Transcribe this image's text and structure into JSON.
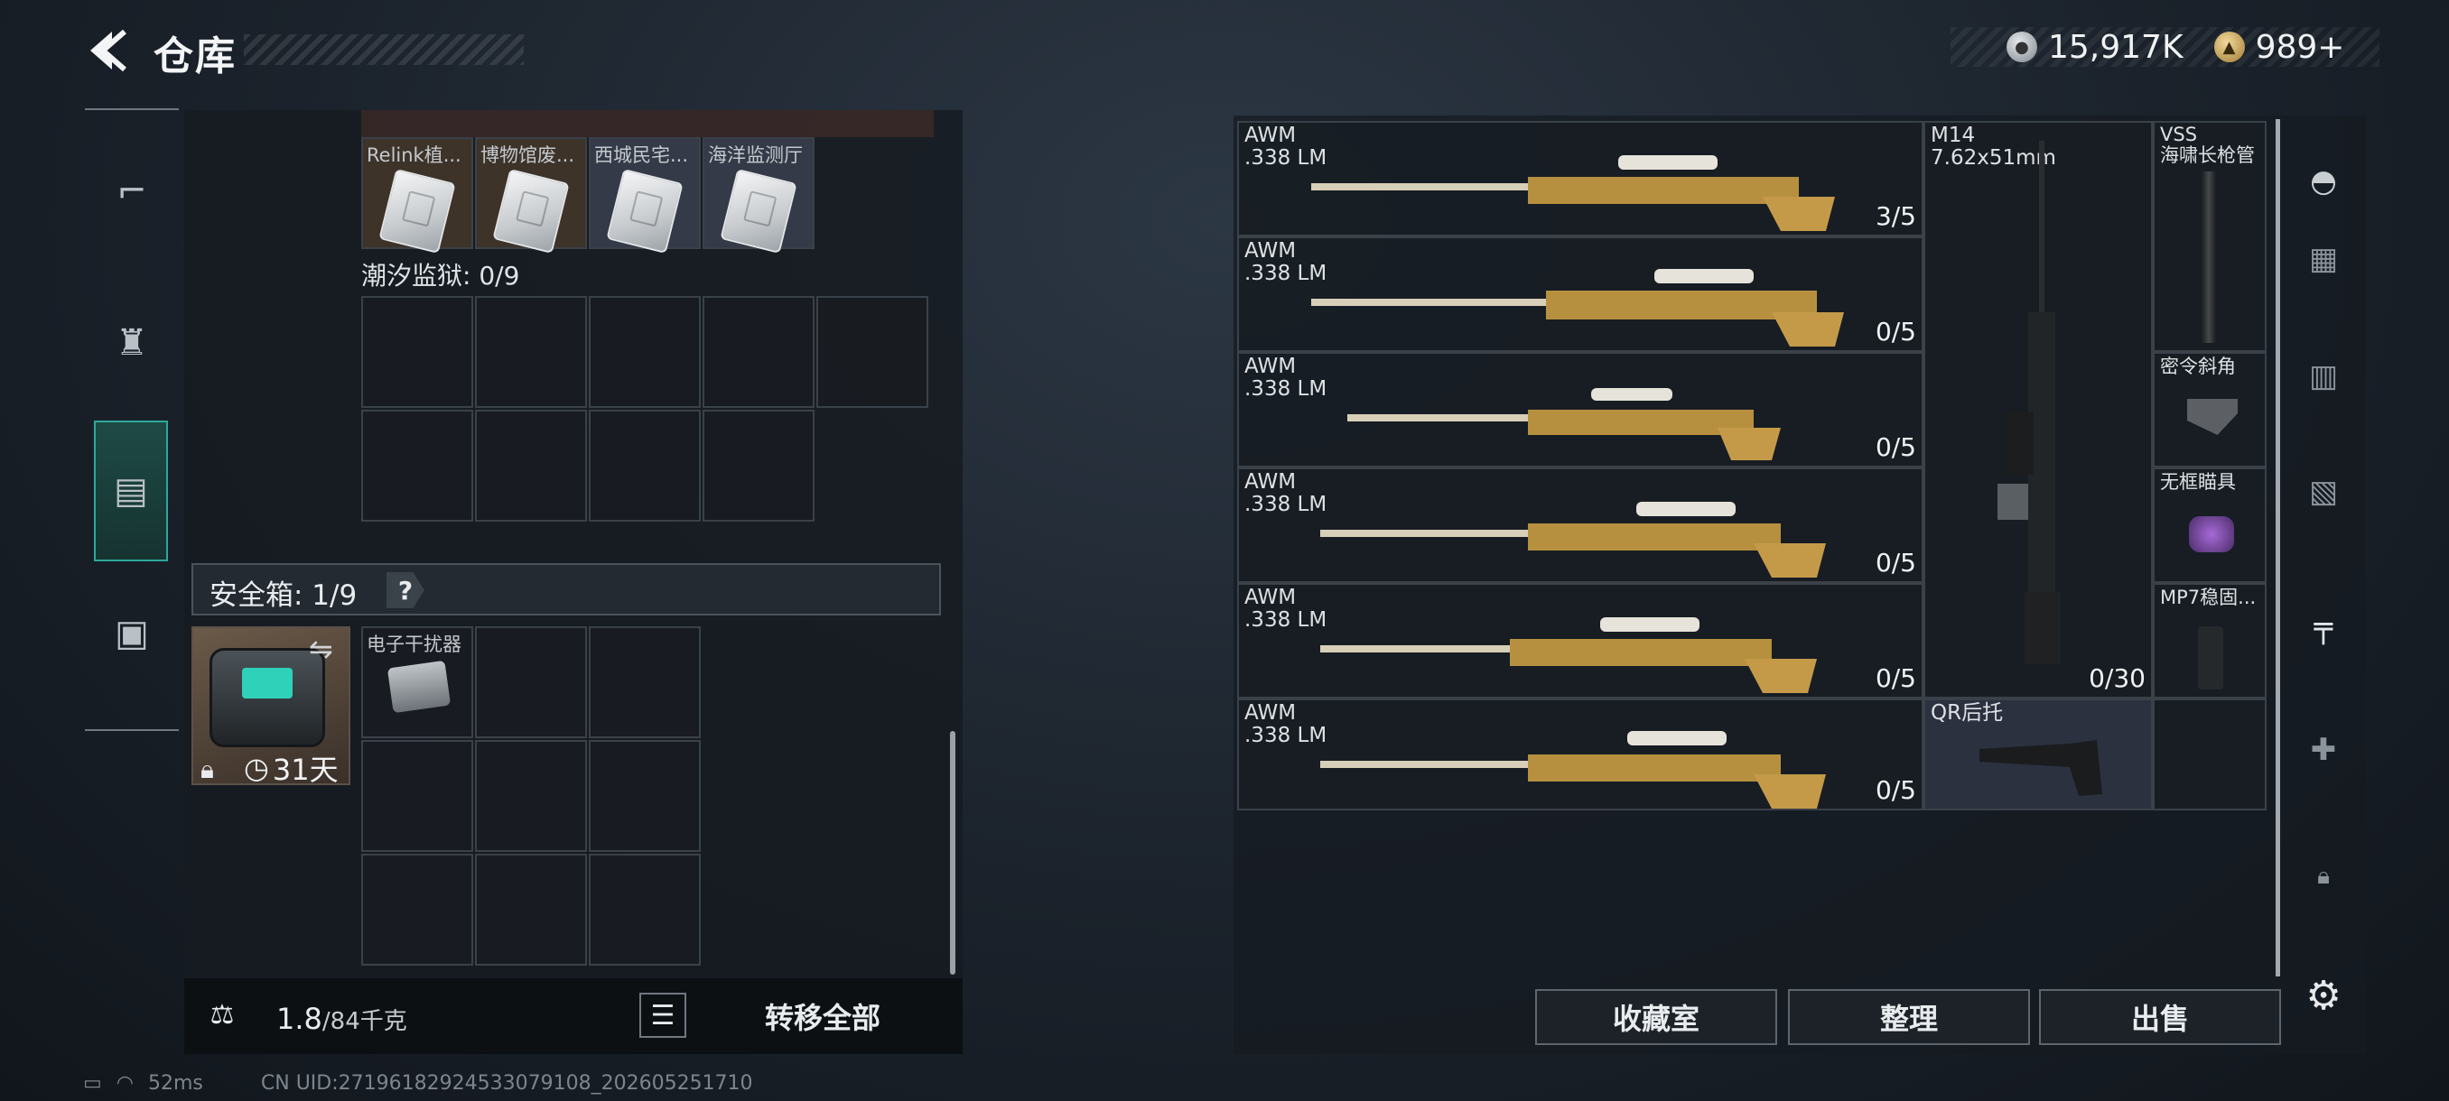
{
  "header": {
    "back_icon": "back-arrow-icon",
    "title": "仓库",
    "currency": [
      {
        "icon": "silver-coin-icon",
        "value": "15,917K"
      },
      {
        "icon": "gold-coin-icon",
        "value": "989+"
      }
    ]
  },
  "left_nav": [
    {
      "icon": "pistol-icon"
    },
    {
      "icon": "armor-bag-icon"
    },
    {
      "icon": "safe-case-icon",
      "active": true
    },
    {
      "icon": "toolbox-icon"
    }
  ],
  "left_panel": {
    "keys_row": [
      "Relink植...",
      "博物馆废...",
      "西城民宅...",
      "海洋监测厅"
    ],
    "tidal_prison": "潮汐监狱: 0/9",
    "safebox": {
      "label": "安全箱: 1/9",
      "help": "?",
      "days": "31天",
      "item_label": "电子干扰器"
    },
    "weight_current": "1.8",
    "weight_max": "/84千克",
    "transfer_all": "转移全部"
  },
  "status_bar": {
    "ping": "52ms",
    "uid": "CN UID:27196182924533079108_202605251710"
  },
  "right_panel": {
    "weapons": [
      {
        "name": "AWM\n.338 LM",
        "count": "3/5"
      },
      {
        "name": "AWM\n.338 LM",
        "count": "0/5"
      },
      {
        "name": "AWM\n.338 LM",
        "count": "0/5"
      },
      {
        "name": "AWM\n.338 LM",
        "count": "0/5"
      },
      {
        "name": "AWM\n.338 LM",
        "count": "0/5"
      },
      {
        "name": "AWM\n.338 LM",
        "count": "0/5"
      }
    ],
    "m14": {
      "name": "M14\n7.62x51mm",
      "count": "0/30"
    },
    "qr_stock": "QR后托",
    "side_items": [
      "VSS\n海啸长枪管",
      "密令斜角",
      "无框瞄具",
      "MP7稳固..."
    ],
    "buttons": {
      "collection": "收藏室",
      "organize": "整理",
      "sell": "出售"
    }
  },
  "right_nav": [
    {
      "icon": "helmet-icon"
    },
    {
      "icon": "armor-tier-icon"
    },
    {
      "icon": "backpack-iv-icon"
    },
    {
      "icon": "rig-iv-icon"
    },
    {
      "icon": "attachment-rack-icon"
    },
    {
      "icon": "medkit-iv-icon"
    },
    {
      "icon": "lock-icon"
    },
    {
      "icon": "settings-icon"
    }
  ]
}
